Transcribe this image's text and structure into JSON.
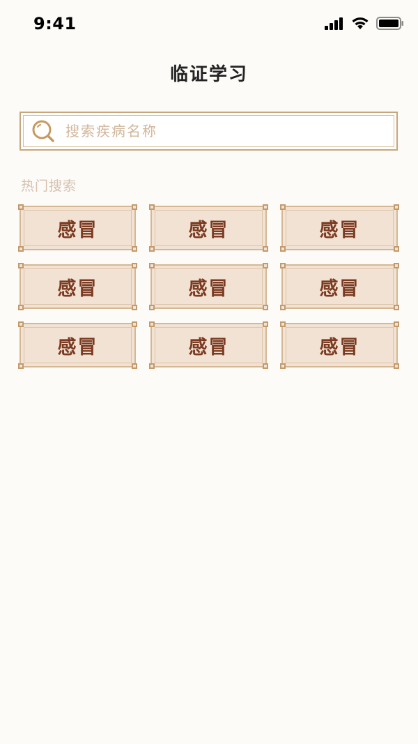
{
  "status_bar": {
    "time": "9:41",
    "icons": [
      "cellular-signal-icon",
      "wifi-icon",
      "battery-icon"
    ]
  },
  "header": {
    "title": "临证学习"
  },
  "search": {
    "placeholder": "搜索疾病名称",
    "value": "",
    "icon": "search-icon"
  },
  "hot_search": {
    "label": "热门搜索",
    "tags": [
      "感冒",
      "感冒",
      "感冒",
      "感冒",
      "感冒",
      "感冒",
      "感冒",
      "感冒",
      "感冒"
    ]
  },
  "colors": {
    "accent_border": "#c8a57a",
    "tag_background": "#f2e2d3",
    "tag_text": "#7a3b22",
    "muted_label": "#d6bfae"
  }
}
